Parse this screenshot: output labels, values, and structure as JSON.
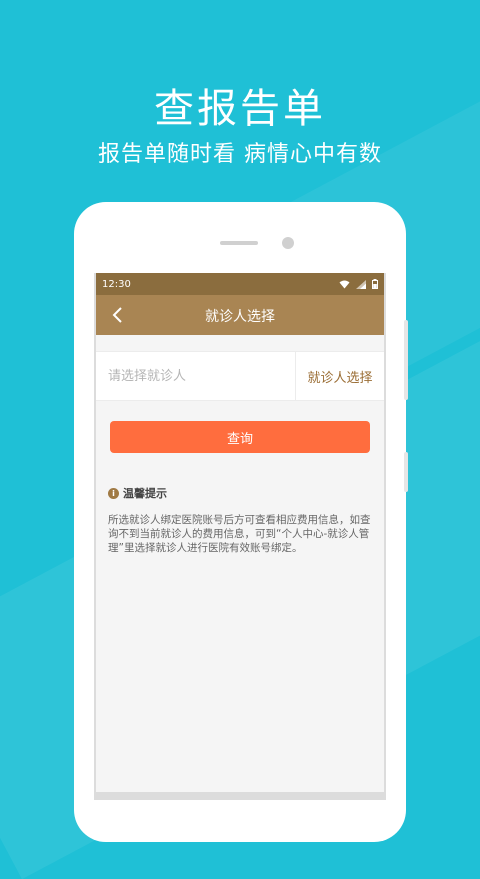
{
  "promo": {
    "title": "查报告单",
    "subtitle": "报告单随时看 病情心中有数"
  },
  "status_bar": {
    "time": "12:30",
    "icons": [
      "wifi-icon",
      "signal-icon",
      "battery-icon"
    ]
  },
  "nav": {
    "title": "就诊人选择",
    "back_icon": "chevron-left-icon"
  },
  "patient_select": {
    "placeholder": "请选择就诊人",
    "value": "",
    "button_label": "就诊人选择"
  },
  "query_button": {
    "label": "查询"
  },
  "tip": {
    "icon": "info-icon",
    "icon_glyph": "i",
    "title": "温馨提示",
    "body": "所选就诊人绑定医院账号后方可查看相应费用信息，如查询不到当前就诊人的费用信息，可到“个人中心-就诊人管理”里选择就诊人进行医院有效账号绑定。"
  },
  "colors": {
    "background": "#1fc0d6",
    "status_bar": "#8b6d3e",
    "nav_bar": "#a98553",
    "accent_text": "#9a6d34",
    "query_button": "#ff6d3e"
  }
}
